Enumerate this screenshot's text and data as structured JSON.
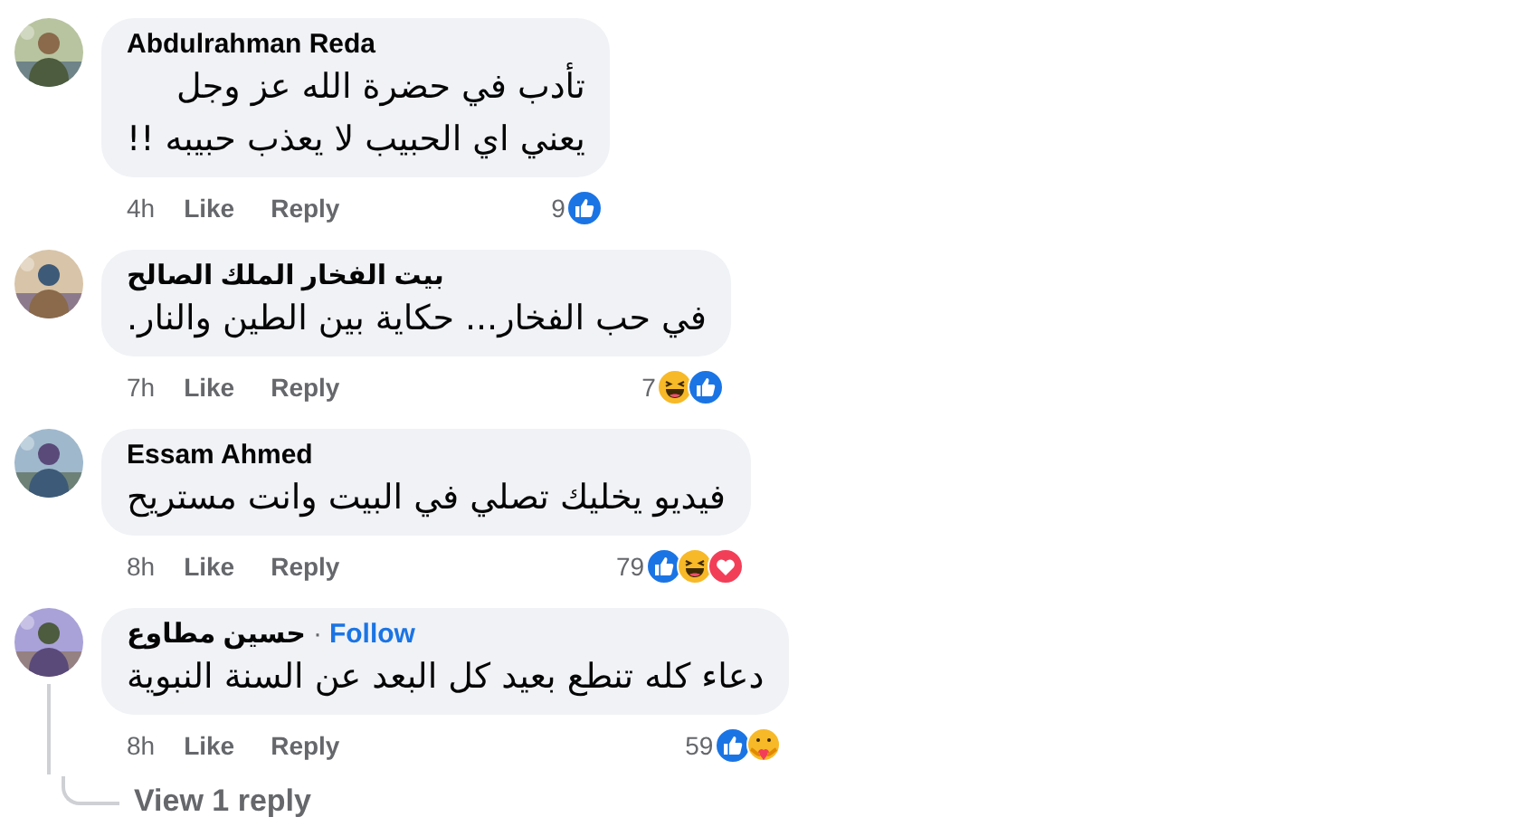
{
  "comments": [
    {
      "author": "Abdulrahman Reda",
      "text": "تأدب في حضرة الله عز وجل\nيعني اي الحبيب لا يعذب حبيبه !!",
      "time": "4h",
      "like_label": "Like",
      "reply_label": "Reply",
      "reaction_count": "9",
      "reactions": [
        {
          "kind": "like"
        }
      ]
    },
    {
      "author": "بيت الفخار الملك الصالح",
      "text": "في حب الفخار... حكاية بين الطين والنار.",
      "time": "7h",
      "like_label": "Like",
      "reply_label": "Reply",
      "reaction_count": "7",
      "reactions": [
        {
          "kind": "haha"
        },
        {
          "kind": "like"
        }
      ]
    },
    {
      "author": "Essam Ahmed",
      "text": "فيديو يخليك تصلي في البيت وانت مستريح",
      "time": "8h",
      "like_label": "Like",
      "reply_label": "Reply",
      "reaction_count": "79",
      "reactions": [
        {
          "kind": "like"
        },
        {
          "kind": "haha"
        },
        {
          "kind": "love"
        }
      ]
    },
    {
      "author": "حسين مطاوع",
      "separator": "·",
      "follow": "Follow",
      "text": "دعاء كله تنطع بعيد كل البعد عن السنة النبوية",
      "time": "8h",
      "like_label": "Like",
      "reply_label": "Reply",
      "reaction_count": "59",
      "reactions": [
        {
          "kind": "like"
        },
        {
          "kind": "care"
        }
      ],
      "view_replies": "View 1 reply"
    }
  ]
}
